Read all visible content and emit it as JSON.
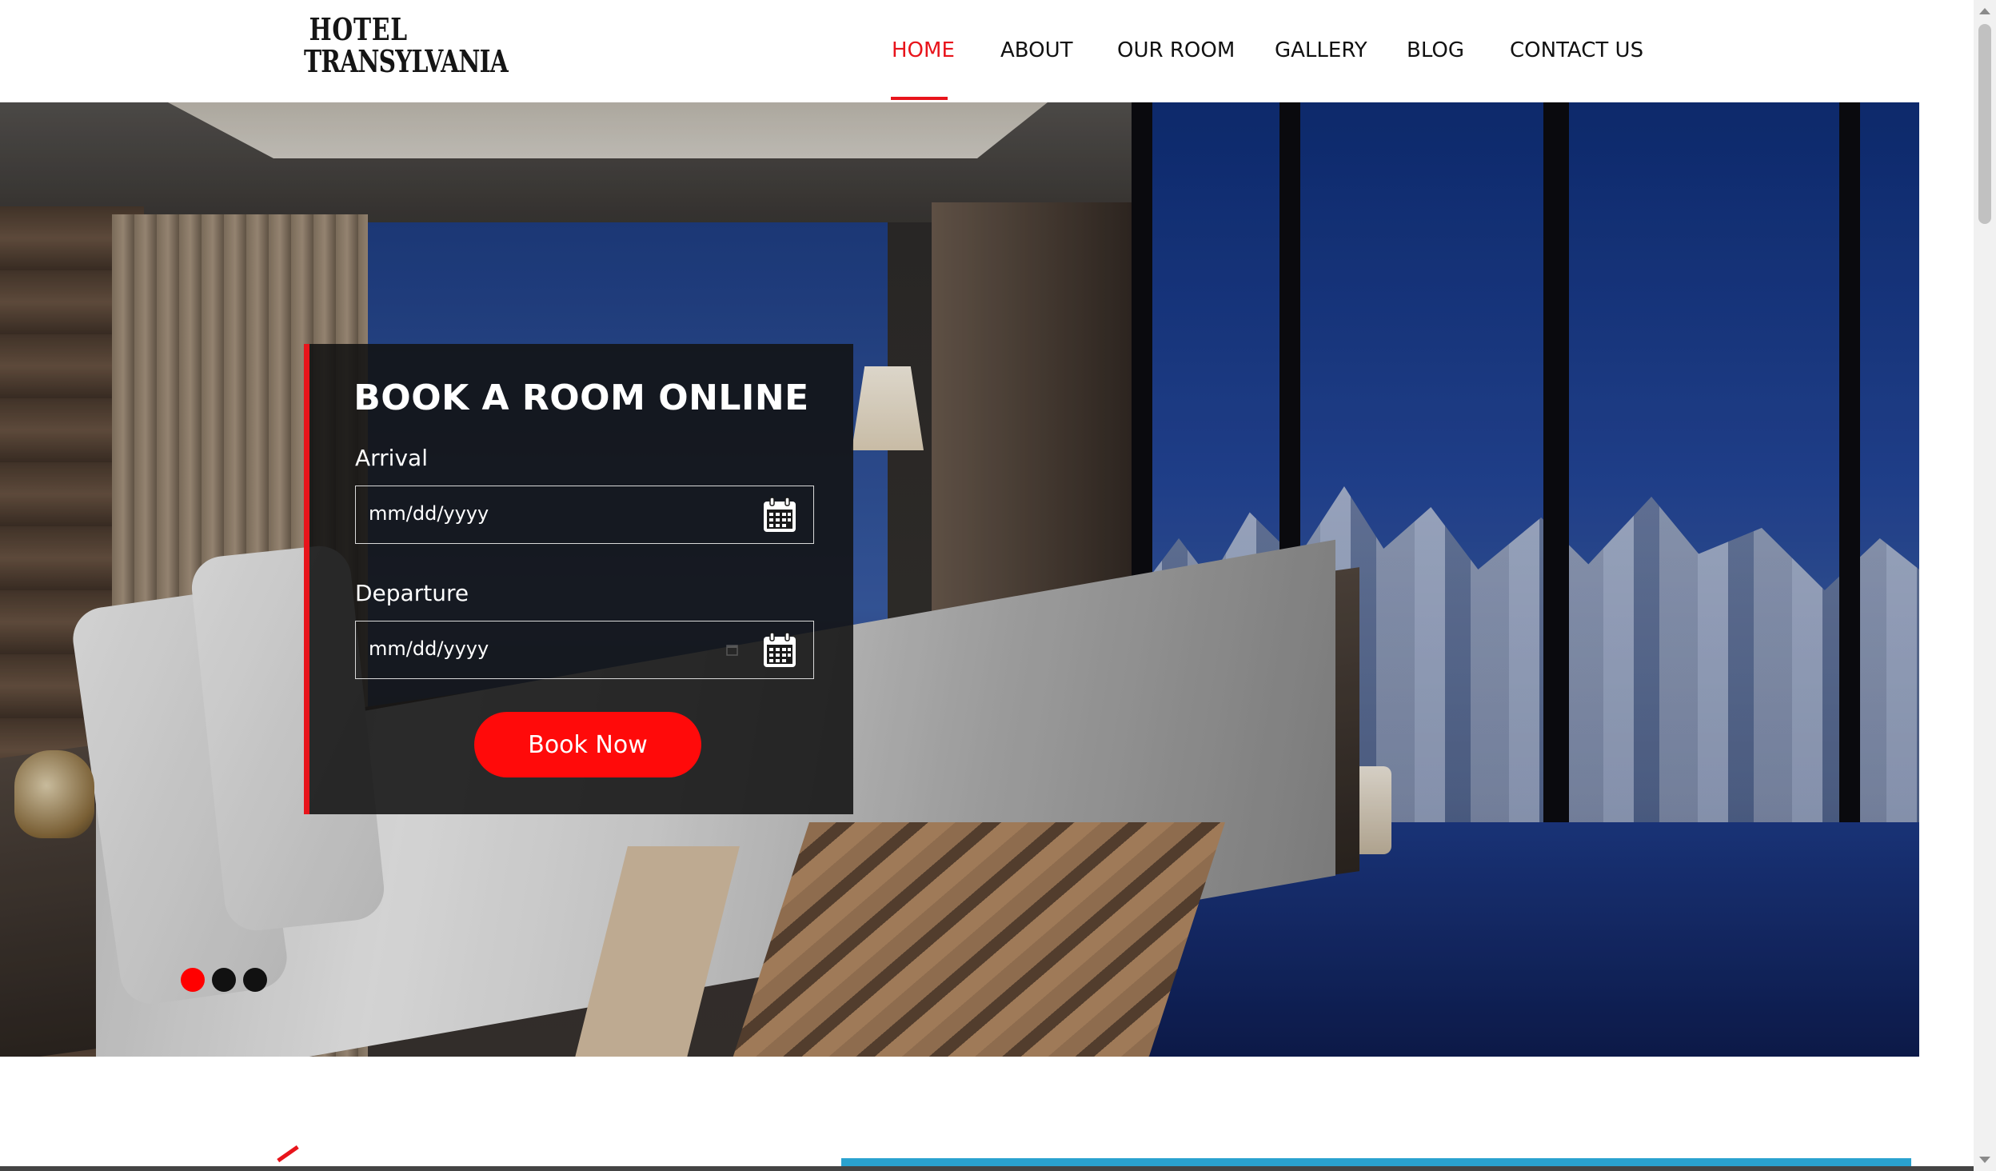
{
  "brand": {
    "logo_line1": "HOTEL",
    "logo_line2": "TRANSYLVANIA"
  },
  "nav": {
    "items": [
      {
        "label": "HOME",
        "active": true
      },
      {
        "label": "ABOUT",
        "active": false
      },
      {
        "label": "OUR ROOM",
        "active": false
      },
      {
        "label": "GALLERY",
        "active": false
      },
      {
        "label": "BLOG",
        "active": false
      },
      {
        "label": "CONTACT US",
        "active": false
      }
    ],
    "active_color": "#e8141b"
  },
  "booking": {
    "title": "BOOK A ROOM ONLINE",
    "arrival_label": "Arrival",
    "arrival_placeholder": "mm/dd/yyyy",
    "departure_label": "Departure",
    "departure_placeholder": "mm/dd/yyyy",
    "button_label": "Book Now",
    "accent_color": "#ff0a0a"
  },
  "slider": {
    "dots": 3,
    "active_index": 0
  },
  "icons": {
    "calendar": "calendar-icon"
  }
}
